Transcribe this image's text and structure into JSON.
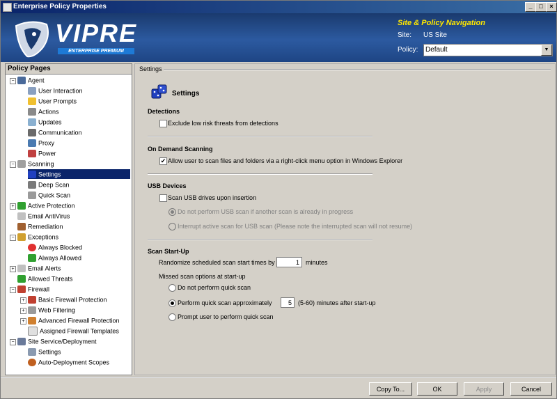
{
  "window": {
    "title": "Enterprise Policy Properties"
  },
  "logo": {
    "text": "VIPRE",
    "sub": "ENTERPRISE PREMIUM"
  },
  "nav": {
    "title": "Site & Policy Navigation",
    "site_label": "Site:",
    "site_value": "US Site",
    "policy_label": "Policy:",
    "policy_value": "Default"
  },
  "left": {
    "header": "Policy Pages",
    "items": [
      {
        "label": "Agent"
      },
      {
        "label": "User Interaction"
      },
      {
        "label": "User Prompts"
      },
      {
        "label": "Actions"
      },
      {
        "label": "Updates"
      },
      {
        "label": "Communication"
      },
      {
        "label": "Proxy"
      },
      {
        "label": "Power"
      },
      {
        "label": "Scanning"
      },
      {
        "label": "Settings"
      },
      {
        "label": "Deep Scan"
      },
      {
        "label": "Quick Scan"
      },
      {
        "label": "Active Protection"
      },
      {
        "label": "Email AntiVirus"
      },
      {
        "label": "Remediation"
      },
      {
        "label": "Exceptions"
      },
      {
        "label": "Always Blocked"
      },
      {
        "label": "Always Allowed"
      },
      {
        "label": "Email Alerts"
      },
      {
        "label": "Allowed Threats"
      },
      {
        "label": "Firewall"
      },
      {
        "label": "Basic Firewall Protection"
      },
      {
        "label": "Web Filtering"
      },
      {
        "label": "Advanced Firewall Protection"
      },
      {
        "label": "Assigned Firewall Templates"
      },
      {
        "label": "Site Service/Deployment"
      },
      {
        "label": "Settings"
      },
      {
        "label": "Auto-Deployment Scopes"
      }
    ]
  },
  "right": {
    "group_label": "Settings",
    "page_title": "Settings",
    "detections": {
      "title": "Detections",
      "exclude_low_risk": "Exclude low risk threats from detections",
      "exclude_low_risk_checked": false
    },
    "on_demand": {
      "title": "On Demand Scanning",
      "allow_right_click": "Allow user to scan files and folders via a right-click menu option in Windows Explorer",
      "allow_right_click_checked": true
    },
    "usb": {
      "title": "USB Devices",
      "scan_usb": "Scan USB drives upon insertion",
      "scan_usb_checked": false,
      "opt_no_scan": "Do not perform USB scan if another scan is already in progress",
      "opt_interrupt": "Interrupt active scan for USB scan (Please note the interrupted scan will not resume)"
    },
    "startup": {
      "title": "Scan Start-Up",
      "randomize_label": "Randomize scheduled scan start times by",
      "randomize_value": "1",
      "randomize_unit": "minutes",
      "missed_label": "Missed scan options at start-up",
      "opt_no_quick": "Do not perform quick scan",
      "opt_quick_approx": "Perform quick scan approximately",
      "quick_value": "5",
      "quick_suffix": "(5-60) minutes after start-up",
      "opt_prompt": "Prompt user to perform quick scan"
    }
  },
  "buttons": {
    "copy_to": "Copy To...",
    "ok": "OK",
    "apply": "Apply",
    "cancel": "Cancel"
  }
}
